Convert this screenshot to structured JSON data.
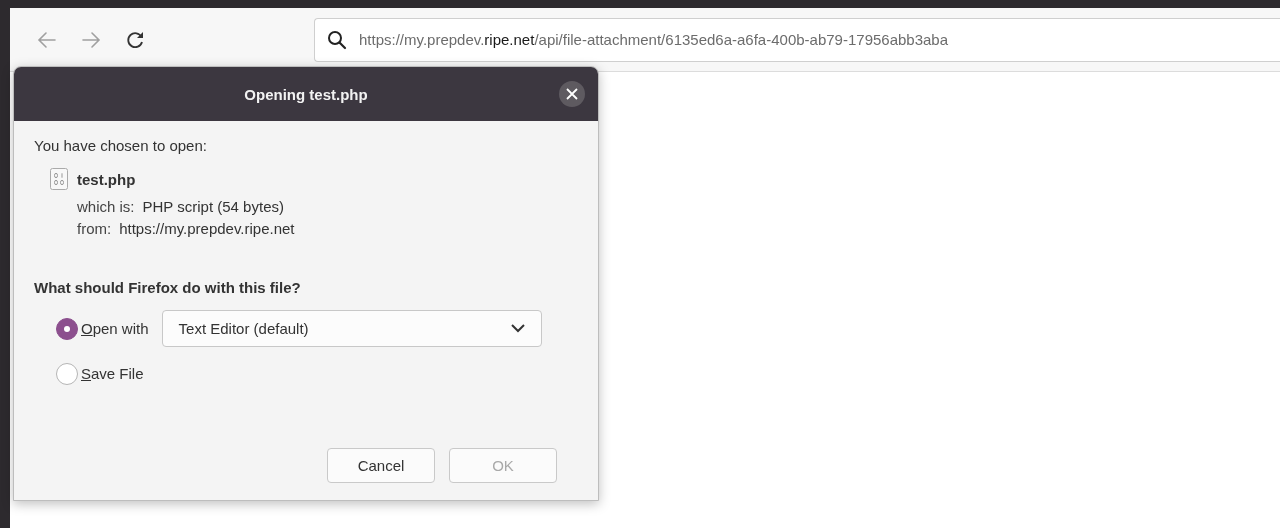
{
  "browser": {
    "back": {
      "disabled": true
    },
    "forward": {
      "disabled": true
    },
    "url": "https://my.prepdev.**ripe.net**/api/file-attachment/6135ed6a-a6fa-400b-ab79-17956abb3aba"
  },
  "dialog": {
    "title": "Opening test.php",
    "intro": "You have chosen to open:",
    "file": {
      "name": "test.php",
      "details": [
        {
          "label": "which is:",
          "value": "PHP script (54 bytes)"
        },
        {
          "label": "from:",
          "value": "https://my.prepdev.ripe.net"
        }
      ]
    },
    "question": "What should Firefox do with this file?",
    "options": [
      {
        "kind": "open-with",
        "label": "Open with",
        "selected": true,
        "app": "Text Editor (default)"
      },
      {
        "kind": "save",
        "label": "Save File",
        "selected": false
      }
    ],
    "buttons": [
      {
        "label": "Cancel",
        "disabled": false
      },
      {
        "label": "OK",
        "disabled": true
      }
    ]
  }
}
